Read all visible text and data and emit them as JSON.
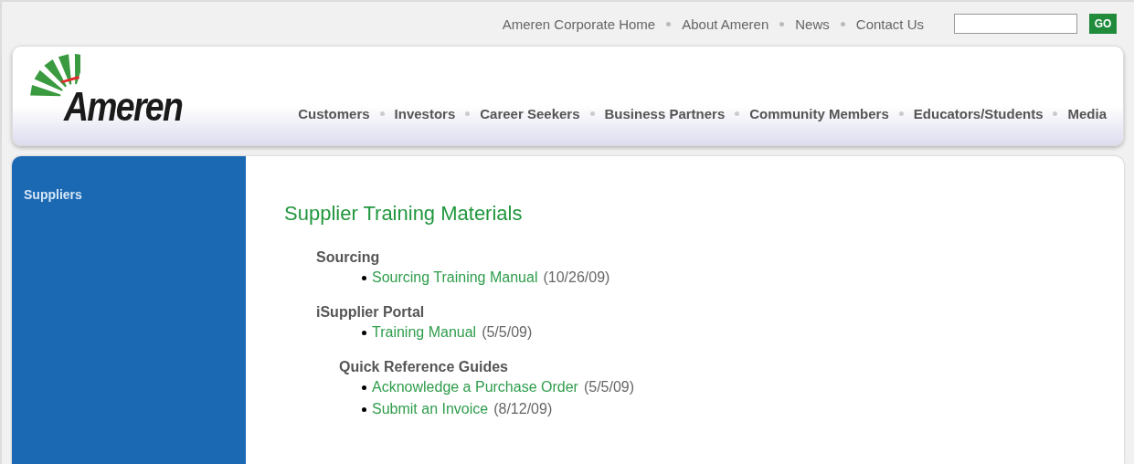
{
  "utility_nav": [
    "Ameren Corporate Home",
    "About Ameren",
    "News",
    "Contact Us"
  ],
  "search": {
    "button": "GO"
  },
  "logo": {
    "text": "Ameren"
  },
  "main_nav": [
    "Customers",
    "Investors",
    "Career Seekers",
    "Business Partners",
    "Community Members",
    "Educators/Students",
    "Media"
  ],
  "sidebar": {
    "items": [
      {
        "label": "Suppliers"
      }
    ]
  },
  "content": {
    "title": "Supplier Training Materials",
    "sections": [
      {
        "kind": "section",
        "heading": "Sourcing",
        "items": [
          {
            "link": "Sourcing Training Manual",
            "date": "(10/26/09)"
          }
        ]
      },
      {
        "kind": "section",
        "heading": "iSupplier Portal",
        "items": [
          {
            "link": "Training Manual",
            "date": "(5/5/09)"
          }
        ]
      },
      {
        "kind": "subsection",
        "heading": "Quick Reference Guides",
        "items": [
          {
            "link": "Acknowledge a Purchase Order",
            "date": "(5/5/09)"
          },
          {
            "link": "Submit an Invoice",
            "date": "(8/12/09)"
          }
        ]
      }
    ]
  }
}
